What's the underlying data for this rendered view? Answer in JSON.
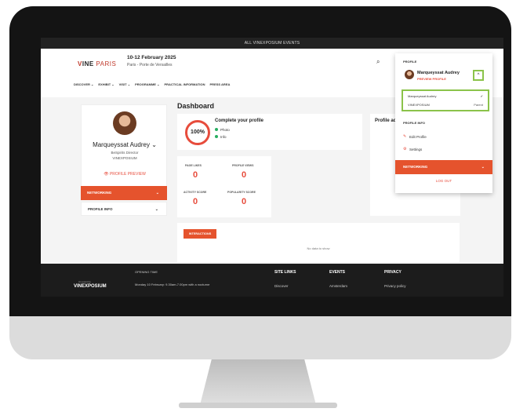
{
  "topbar": {
    "text": "ALL VINEXPOSIUM EVENTS"
  },
  "header": {
    "logo_v": "V",
    "logo_ine": "INE",
    "logo_paris": " PARIS",
    "date": "10-12 February 2025",
    "location": "Paris - Porte de Versailles"
  },
  "nav": [
    "DISCOVER ⌄",
    "EXHIBIT ⌄",
    "VISIT ⌄",
    "PROGRAMME ⌄",
    "PRACTICAL INFORMATION",
    "PRESS AREA"
  ],
  "profile_card": {
    "name": "Marqueyssat Audrey ⌄",
    "role": "BeSpirits Director",
    "org": "VINEXPOSIUM",
    "preview": "👁 PROFILE PREVIEW"
  },
  "sidebar": {
    "networking": "NETWORKING",
    "profile_info": "PROFILE INFO"
  },
  "dashboard": {
    "title": "Dashboard",
    "complete": {
      "percent": "100%",
      "title": "Complete your profile",
      "items": [
        "Photo",
        "Info"
      ]
    },
    "stats": [
      {
        "label": "PAGE LIKES",
        "value": "0"
      },
      {
        "label": "PROFILE VIEWS",
        "value": "0"
      },
      {
        "label": "ACTIVITY SCORE",
        "value": "0"
      },
      {
        "label": "POPULARITY SCORE",
        "value": "0"
      }
    ],
    "profile_activity_title": "Profile ac",
    "interactions": "INTERACTIONS",
    "no_data": "No data to show"
  },
  "dropdown": {
    "profile_label": "PROFILE",
    "name": "Marqueyssat Audrey",
    "preview": "PREVIEW PROFILE",
    "caret": "^",
    "accounts": [
      {
        "name": "Marqueyssat Audrey",
        "status": "✔"
      },
      {
        "name": "VINEXPOSIUM",
        "status": "Parent"
      }
    ],
    "profile_info": "PROFILE INFO",
    "edit": "Edit Profile",
    "settings": "Settings",
    "networking": "NETWORKING",
    "logout": "LOG OUT"
  },
  "footer": {
    "small": "An event by",
    "logo": "VINEXPOSIUM",
    "opening_title": "OPENING TIME",
    "opening_text": "Monday 10 February: 9.30am-7.00pm with a nocturne",
    "site_links": "SITE LINKS",
    "site_link_1": "Discover",
    "events": "EVENTS",
    "event_1": "Amsterdam",
    "privacy": "PRIVACY",
    "privacy_1": "Privacy policy"
  },
  "colors": {
    "accent": "#e5532d",
    "highlight": "#8bc34a",
    "ring": "#e74c3c"
  }
}
